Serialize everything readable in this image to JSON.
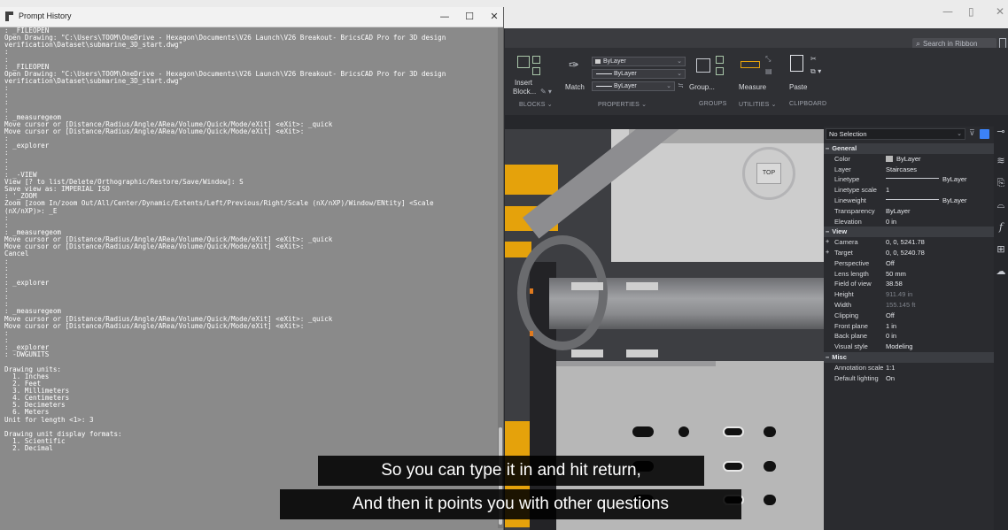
{
  "prompt_history": {
    "title": "Prompt History",
    "controls": {
      "minimize": "—",
      "maximize": "☐",
      "close": "✕"
    },
    "lines": [
      ": _FILEOPEN",
      "Open Drawing: \"C:\\Users\\TOOM\\OneDrive - Hexagon\\Documents\\V26 Launch\\V26 Breakout- BricsCAD Pro for 3D design",
      "verification\\Dataset\\submarine_3D_start.dwg\"",
      ":",
      ":",
      ": _FILEOPEN",
      "Open Drawing: \"C:\\Users\\TOOM\\OneDrive - Hexagon\\Documents\\V26 Launch\\V26 Breakout- BricsCAD Pro for 3D design",
      "verification\\Dataset\\submarine_3D_start.dwg\"",
      ":",
      ":",
      ":",
      ":",
      ": _measuregeom",
      "Move cursor or [Distance/Radius/Angle/ARea/Volume/Quick/Mode/eXit] <eXit>: _quick",
      "Move cursor or [Distance/Radius/Angle/ARea/Volume/Quick/Mode/eXit] <eXit>:",
      ":",
      ": _explorer",
      ":",
      ":",
      ":",
      ": _-VIEW",
      "View [? to list/Delete/Orthographic/Restore/Save/Window]: S",
      "Save view as: IMPERIAL ISO",
      ": '_ZOOM",
      "Zoom [zoom In/zoom Out/All/Center/Dynamic/Extents/Left/Previous/Right/Scale (nX/nXP)/Window/ENtity] <Scale",
      "(nX/nXP)>: _E",
      ":",
      ":",
      ": _measuregeom",
      "Move cursor or [Distance/Radius/Angle/ARea/Volume/Quick/Mode/eXit] <eXit>: _quick",
      "Move cursor or [Distance/Radius/Angle/ARea/Volume/Quick/Mode/eXit] <eXit>:",
      "Cancel",
      ":",
      ":",
      ":",
      ": _explorer",
      ":",
      ":",
      ":",
      ": _measuregeom",
      "Move cursor or [Distance/Radius/Angle/ARea/Volume/Quick/Mode/eXit] <eXit>: _quick",
      "Move cursor or [Distance/Radius/Angle/ARea/Volume/Quick/Mode/eXit] <eXit>:",
      ":",
      ":",
      ": _explorer",
      ": -DWGUNITS",
      "",
      "Drawing units:",
      "  1. Inches",
      "  2. Feet",
      "  3. Millimeters",
      "  4. Centimeters",
      "  5. Decimeters",
      "  6. Meters",
      "Unit for length <1>: 3",
      "",
      "Drawing unit display formats:",
      "  1. Scientific",
      "  2. Decimal"
    ]
  },
  "ribbon": {
    "search_placeholder": "Search in Ribbon",
    "blocks": {
      "insert_label": "Insert",
      "block_label": "Block...",
      "group": "BLOCKS"
    },
    "properties": {
      "match_label": "Match",
      "color": "ByLayer",
      "linetype": "ByLayer",
      "lineweight": "ByLayer",
      "group": "PROPERTIES"
    },
    "groups_section": {
      "label": "Group...",
      "group": "GROUPS"
    },
    "utilities": {
      "measure_label": "Measure",
      "group": "UTILITIES"
    },
    "clipboard": {
      "paste_label": "Paste",
      "group": "CLIPBOARD"
    }
  },
  "viewcube": {
    "face_label": "TOP"
  },
  "properties_panel": {
    "selection": "No Selection",
    "rows": [
      {
        "type": "cat",
        "label": "General",
        "toggle": "−"
      },
      {
        "type": "prop",
        "key": "Color",
        "value": "ByLayer",
        "swatch": true
      },
      {
        "type": "prop",
        "key": "Layer",
        "value": "Staircases"
      },
      {
        "type": "prop",
        "key": "Linetype",
        "value": "ByLayer",
        "line": true
      },
      {
        "type": "prop",
        "key": "Linetype scale",
        "value": "1"
      },
      {
        "type": "prop",
        "key": "Lineweight",
        "value": "ByLayer",
        "line": true
      },
      {
        "type": "prop",
        "key": "Transparency",
        "value": "ByLayer"
      },
      {
        "type": "prop",
        "key": "Elevation",
        "value": "0 in"
      },
      {
        "type": "cat",
        "label": "View",
        "toggle": "−"
      },
      {
        "type": "prop",
        "key": "Camera",
        "value": "0, 0, 5241.78",
        "expand": "+"
      },
      {
        "type": "prop",
        "key": "Target",
        "value": "0, 0, 5240.78",
        "expand": "+"
      },
      {
        "type": "prop",
        "key": "Perspective",
        "value": "Off"
      },
      {
        "type": "prop",
        "key": "Lens length",
        "value": "50 mm"
      },
      {
        "type": "prop",
        "key": "Field of view",
        "value": "38.58"
      },
      {
        "type": "prop",
        "key": "Height",
        "value": "911.49 in",
        "dim": true
      },
      {
        "type": "prop",
        "key": "Width",
        "value": "155.145 ft",
        "dim": true
      },
      {
        "type": "prop",
        "key": "Clipping",
        "value": "Off"
      },
      {
        "type": "prop",
        "key": "Front plane",
        "value": "1 in"
      },
      {
        "type": "prop",
        "key": "Back plane",
        "value": "0 in"
      },
      {
        "type": "prop",
        "key": "Visual style",
        "value": "Modeling"
      },
      {
        "type": "cat",
        "label": "Misc",
        "toggle": "−"
      },
      {
        "type": "prop",
        "key": "Annotation scale",
        "value": "1:1"
      },
      {
        "type": "prop",
        "key": "Default lighting",
        "value": "On"
      }
    ]
  },
  "subtitles": {
    "line1": "So you can type it in and hit return,",
    "line2": "And then it points you with other questions"
  },
  "colors": {
    "prompt_bg": "#8a8a8a",
    "panel_bg": "#2a2b2f",
    "accent_yellow": "#e5a20b",
    "accent_blue": "#3c82f6"
  }
}
